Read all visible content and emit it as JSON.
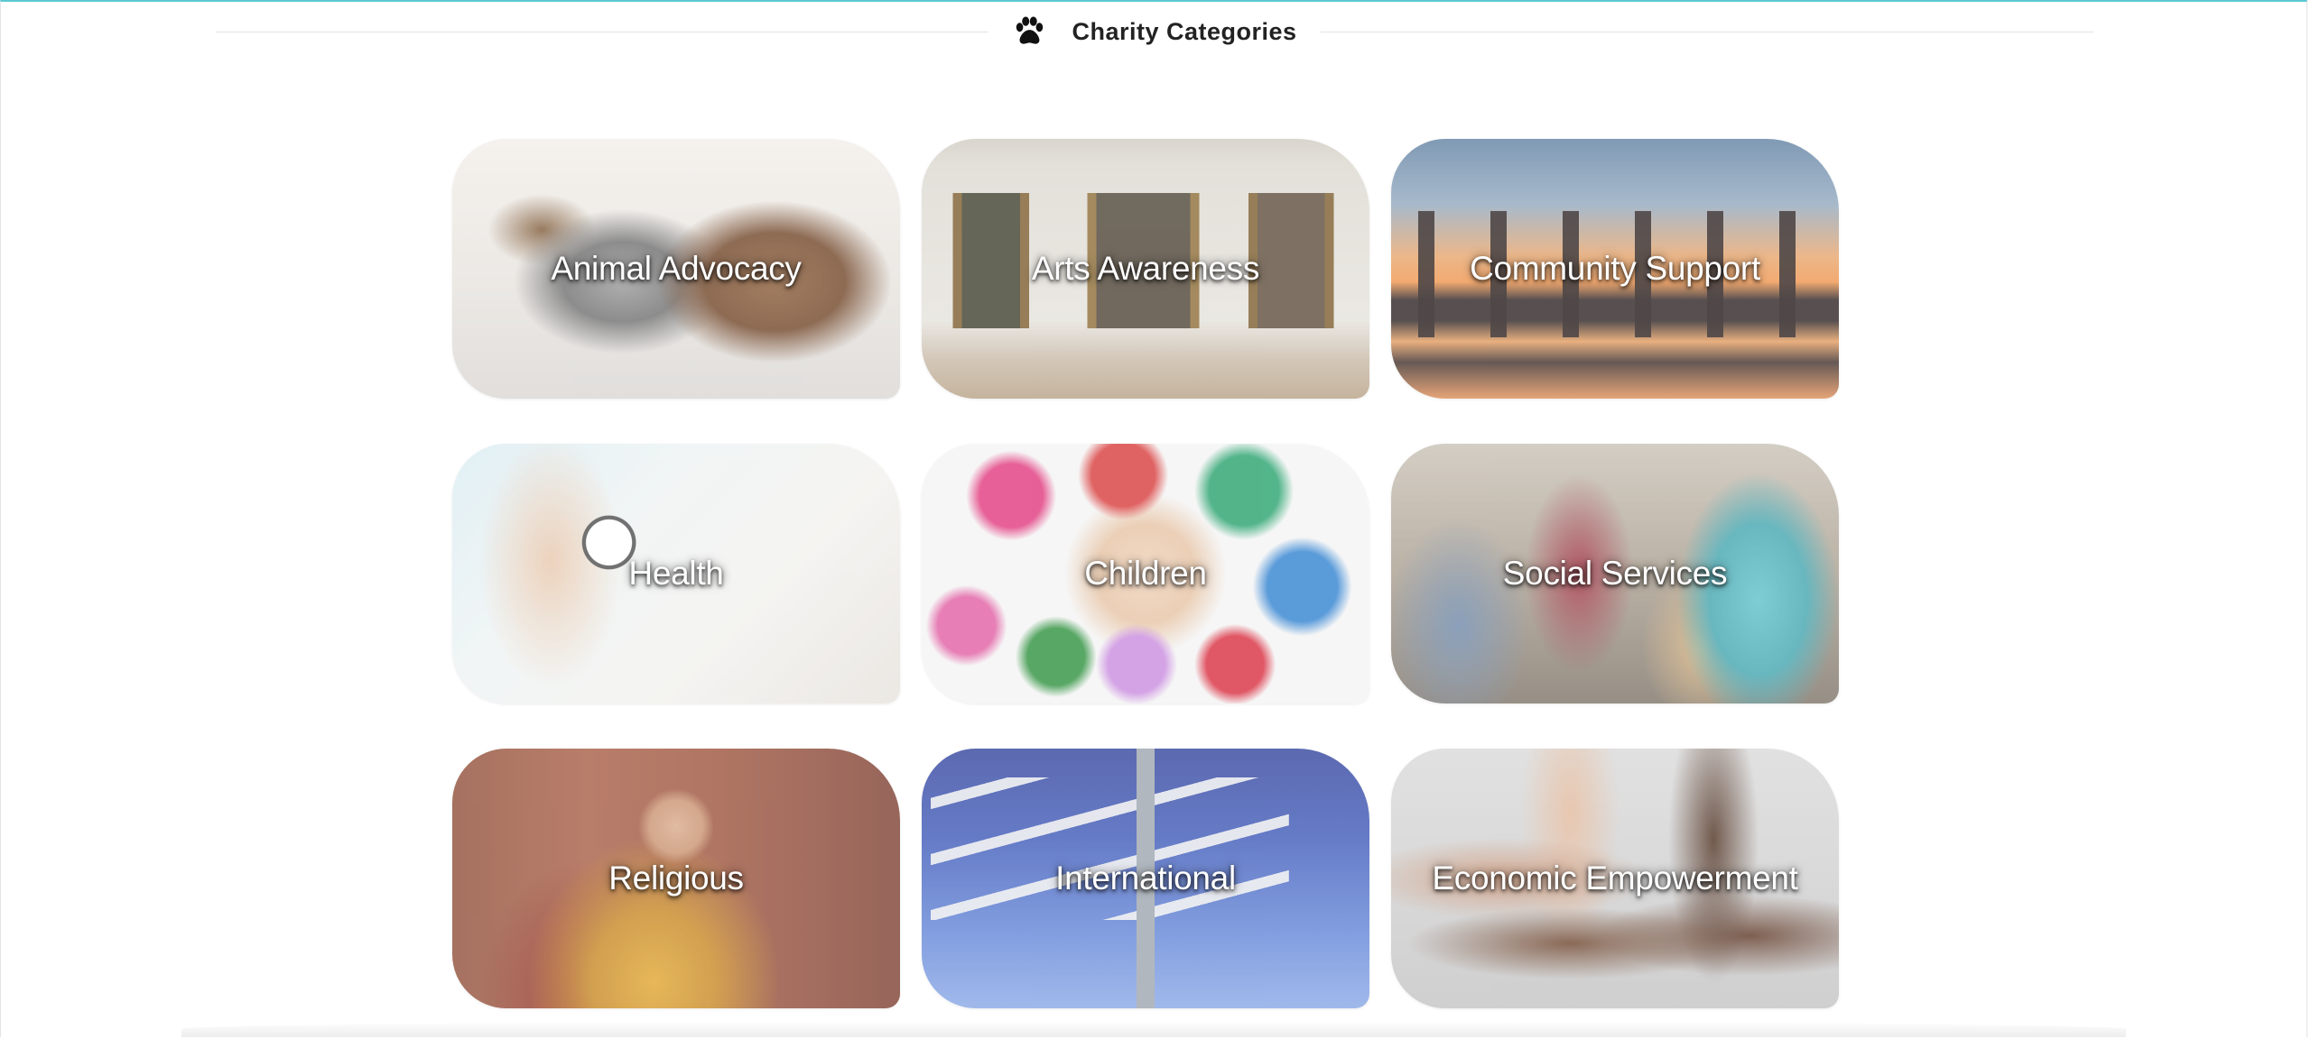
{
  "section": {
    "title": "Charity Categories",
    "icon": "paw-icon"
  },
  "accent_color": "#5bc8d2",
  "categories": [
    {
      "label": "Animal Advocacy",
      "art": "art-animal"
    },
    {
      "label": "Arts Awareness",
      "art": "art-arts"
    },
    {
      "label": "Community Support",
      "art": "art-community"
    },
    {
      "label": "Health",
      "art": "art-health"
    },
    {
      "label": "Children",
      "art": "art-children"
    },
    {
      "label": "Social Services",
      "art": "art-social"
    },
    {
      "label": "Religious",
      "art": "art-religious"
    },
    {
      "label": "International",
      "art": "art-international"
    },
    {
      "label": "Economic Empowerment",
      "art": "art-economic"
    }
  ]
}
